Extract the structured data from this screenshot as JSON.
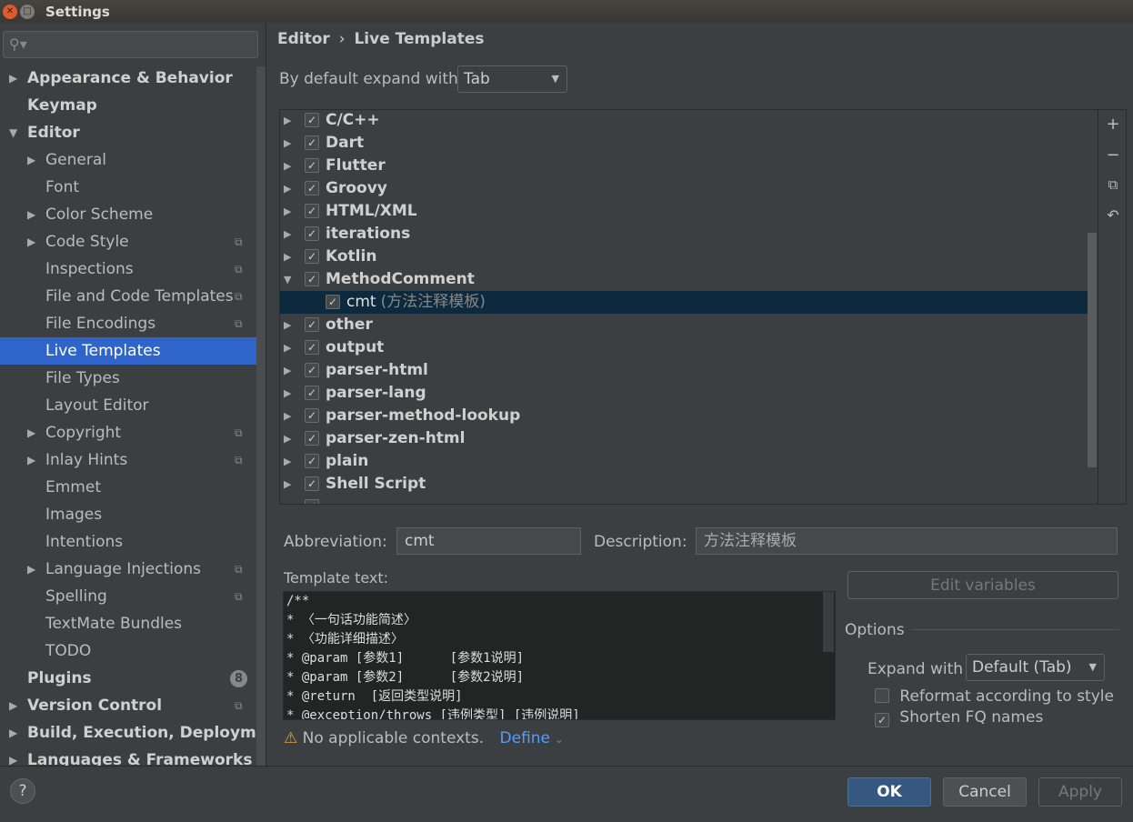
{
  "window": {
    "title": "Settings"
  },
  "sidebar": {
    "search_placeholder": "",
    "items": [
      {
        "label": "Appearance & Behavior",
        "bold": true,
        "arrow": "right",
        "indent": 0
      },
      {
        "label": "Keymap",
        "bold": true,
        "indent": 0
      },
      {
        "label": "Editor",
        "bold": true,
        "arrow": "down",
        "indent": 0
      },
      {
        "label": "General",
        "arrow": "right",
        "indent": 1
      },
      {
        "label": "Font",
        "indent": 1
      },
      {
        "label": "Color Scheme",
        "arrow": "right",
        "indent": 1
      },
      {
        "label": "Code Style",
        "arrow": "right",
        "indent": 1,
        "copy": true
      },
      {
        "label": "Inspections",
        "indent": 1,
        "copy": true
      },
      {
        "label": "File and Code Templates",
        "indent": 1,
        "copy": true
      },
      {
        "label": "File Encodings",
        "indent": 1,
        "copy": true
      },
      {
        "label": "Live Templates",
        "indent": 1,
        "selected": true
      },
      {
        "label": "File Types",
        "indent": 1
      },
      {
        "label": "Layout Editor",
        "indent": 1
      },
      {
        "label": "Copyright",
        "arrow": "right",
        "indent": 1,
        "copy": true
      },
      {
        "label": "Inlay Hints",
        "arrow": "right",
        "indent": 1,
        "copy": true
      },
      {
        "label": "Emmet",
        "indent": 1
      },
      {
        "label": "Images",
        "indent": 1
      },
      {
        "label": "Intentions",
        "indent": 1
      },
      {
        "label": "Language Injections",
        "arrow": "right",
        "indent": 1,
        "copy": true
      },
      {
        "label": "Spelling",
        "indent": 1,
        "copy": true
      },
      {
        "label": "TextMate Bundles",
        "indent": 1
      },
      {
        "label": "TODO",
        "indent": 1
      },
      {
        "label": "Plugins",
        "bold": true,
        "indent": 0,
        "badge": "8"
      },
      {
        "label": "Version Control",
        "bold": true,
        "arrow": "right",
        "indent": 0,
        "copy": true
      },
      {
        "label": "Build, Execution, Deployment",
        "bold": true,
        "arrow": "right",
        "indent": 0
      },
      {
        "label": "Languages & Frameworks",
        "bold": true,
        "arrow": "right",
        "indent": 0
      }
    ]
  },
  "breadcrumb": {
    "parent": "Editor",
    "separator": "›",
    "current": "Live Templates"
  },
  "expand": {
    "label": "By default expand with",
    "value": "Tab"
  },
  "tree": [
    {
      "label": "C/C++",
      "checked": true
    },
    {
      "label": "Dart",
      "checked": true
    },
    {
      "label": "Flutter",
      "checked": true
    },
    {
      "label": "Groovy",
      "checked": true
    },
    {
      "label": "HTML/XML",
      "checked": true
    },
    {
      "label": "iterations",
      "checked": true
    },
    {
      "label": "Kotlin",
      "checked": true
    },
    {
      "label": "MethodComment",
      "checked": true,
      "expanded": true
    },
    {
      "label": "cmt",
      "desc": "(方法注释模板)",
      "checked": true,
      "child": true,
      "selected": true
    },
    {
      "label": "other",
      "checked": true
    },
    {
      "label": "output",
      "checked": true
    },
    {
      "label": "parser-html",
      "checked": true
    },
    {
      "label": "parser-lang",
      "checked": true
    },
    {
      "label": "parser-method-lookup",
      "checked": true
    },
    {
      "label": "parser-zen-html",
      "checked": true
    },
    {
      "label": "plain",
      "checked": true
    },
    {
      "label": "Shell Script",
      "checked": true
    },
    {
      "label": "...",
      "checked": true
    }
  ],
  "tools": [
    "plus-icon",
    "minus-icon",
    "copy-icon",
    "undo-icon"
  ],
  "form": {
    "abbreviation_label": "Abbreviation:",
    "abbreviation": "cmt",
    "description_label": "Description:",
    "description": "方法注释模板",
    "template_label": "Template text:",
    "edit_variables": "Edit variables"
  },
  "template_lines": [
    "/**",
    "* 〈一句话功能简述〉",
    "* 〈功能详细描述〉",
    "* @param [参数1]      [参数1说明]",
    "* @param [参数2]      [参数2说明]",
    "* @return  [返回类型说明]",
    "* @exception/throws [违例类型] [违例说明]"
  ],
  "contexts": {
    "warning": "No applicable contexts.",
    "define": "Define"
  },
  "options": {
    "title": "Options",
    "expand_label": "Expand with",
    "expand_value": "Default (Tab)",
    "reformat": "Reformat according to style",
    "reformat_checked": false,
    "shorten": "Shorten FQ names",
    "shorten_checked": true
  },
  "buttons": {
    "help": "?",
    "ok": "OK",
    "cancel": "Cancel",
    "apply": "Apply"
  }
}
